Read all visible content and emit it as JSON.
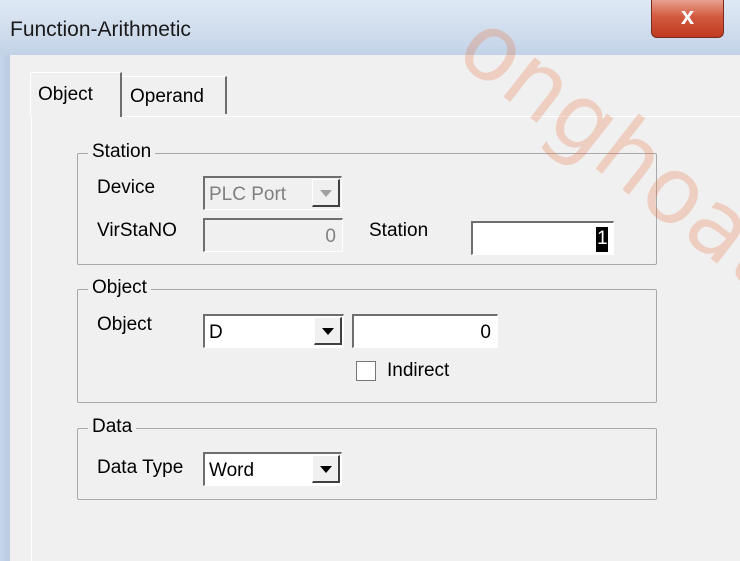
{
  "window": {
    "title": "Function-Arithmetic",
    "close_symbol": "x"
  },
  "tabs": [
    {
      "label": "Object",
      "active": true
    },
    {
      "label": "Operand",
      "active": false
    }
  ],
  "station": {
    "group_title": "Station",
    "device_label": "Device",
    "device_value": "PLC Port",
    "virstano_label": "VirStaNO",
    "virstano_value": "0",
    "station_label": "Station",
    "station_value": "1"
  },
  "object": {
    "group_title": "Object",
    "object_label": "Object",
    "object_type": "D",
    "object_address": "0",
    "indirect_label": "Indirect",
    "indirect_checked": false
  },
  "data": {
    "group_title": "Data",
    "data_type_label": "Data Type",
    "data_type_value": "Word"
  },
  "watermark": {
    "text": "onghoato"
  }
}
